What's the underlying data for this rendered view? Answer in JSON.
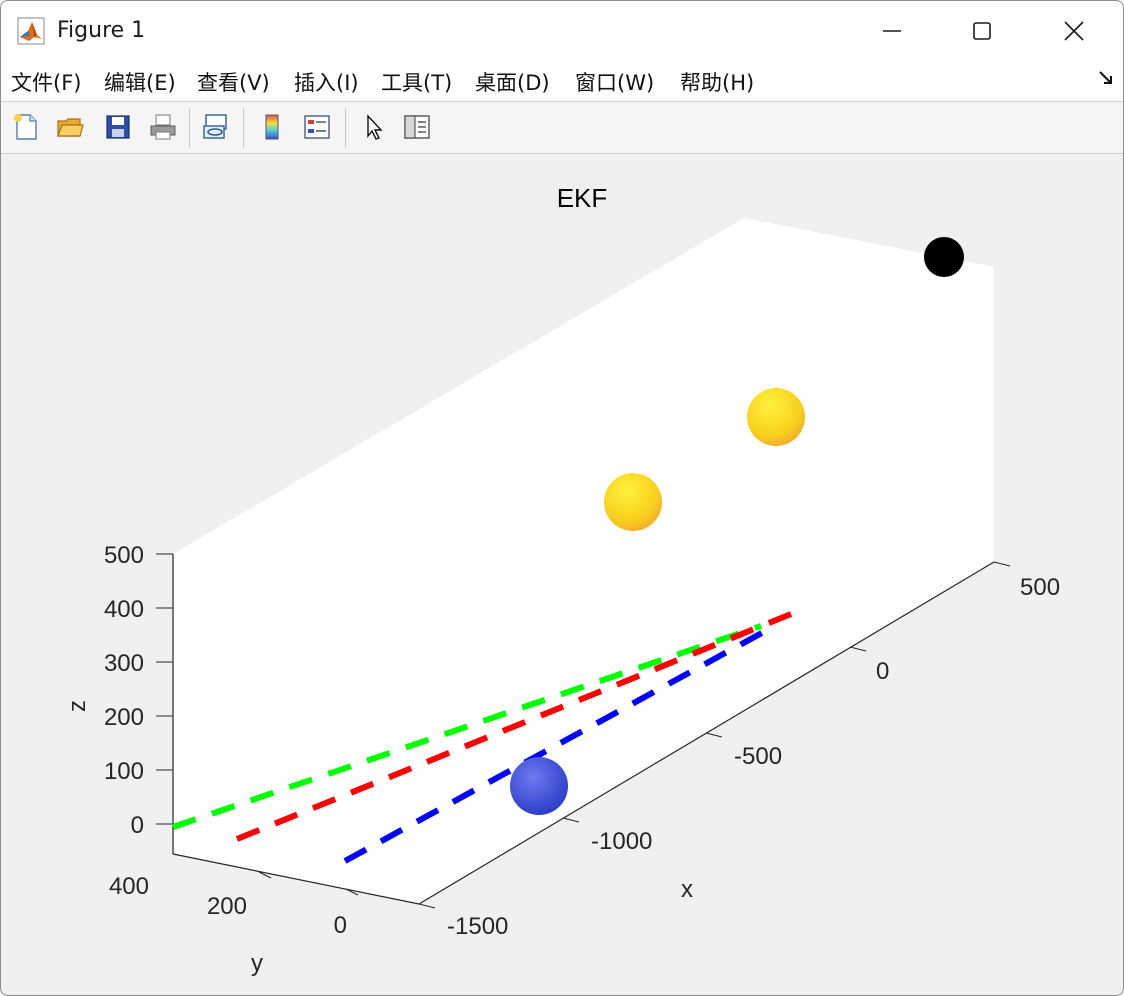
{
  "window": {
    "title": "Figure 1",
    "controls": {
      "minimize": "minimize-icon",
      "maximize": "maximize-icon",
      "close": "close-icon"
    }
  },
  "menubar": {
    "items": [
      {
        "label": "文件(F)"
      },
      {
        "label": "编辑(E)"
      },
      {
        "label": "查看(V)"
      },
      {
        "label": "插入(I)"
      },
      {
        "label": "工具(T)"
      },
      {
        "label": "桌面(D)"
      },
      {
        "label": "窗口(W)"
      },
      {
        "label": "帮助(H)"
      }
    ]
  },
  "toolbar": {
    "buttons": [
      {
        "icon": "new-figure-icon"
      },
      {
        "icon": "open-file-icon"
      },
      {
        "icon": "save-icon"
      },
      {
        "icon": "print-icon"
      },
      {
        "icon": "link-plot-icon"
      },
      {
        "icon": "colorbar-icon"
      },
      {
        "icon": "legend-icon"
      },
      {
        "icon": "edit-plot-pointer-icon"
      },
      {
        "icon": "property-inspector-icon"
      }
    ]
  },
  "chart_data": {
    "type": "scatter",
    "title": "EKF",
    "xlabel": "x",
    "ylabel": "y",
    "zlabel": "z",
    "xlim": [
      -1500,
      500
    ],
    "ylim": [
      0,
      400
    ],
    "zlim": [
      0,
      500
    ],
    "xticks": [
      "-1500",
      "-1000",
      "-500",
      "0",
      "500"
    ],
    "yticks": [
      "400",
      "200",
      "0"
    ],
    "zticks": [
      "500",
      "400",
      "300",
      "200",
      "100",
      "0"
    ],
    "series": [
      {
        "style": "dashed",
        "color": "#00ff00",
        "x": [
          -1500,
          300
        ],
        "y": [
          350,
          350
        ],
        "z": [
          0,
          0
        ]
      },
      {
        "style": "dashed",
        "color": "#ff0000",
        "x": [
          -1400,
          300
        ],
        "y": [
          230,
          230
        ],
        "z": [
          0,
          0
        ]
      },
      {
        "style": "dashed",
        "color": "#0000ff",
        "x": [
          -1500,
          250
        ],
        "y": [
          50,
          50
        ],
        "z": [
          0,
          0
        ]
      }
    ],
    "spheres": [
      {
        "color": "#3b4bd8",
        "x": -1000,
        "y": 0,
        "z": 40
      },
      {
        "color": "#f5c518",
        "x": -350,
        "y": 120,
        "z": 420
      },
      {
        "color": "#f5c518",
        "x": 0,
        "y": 100,
        "z": 480
      },
      {
        "color": "#000000",
        "x": 500,
        "y": 0,
        "z": 500
      }
    ]
  }
}
